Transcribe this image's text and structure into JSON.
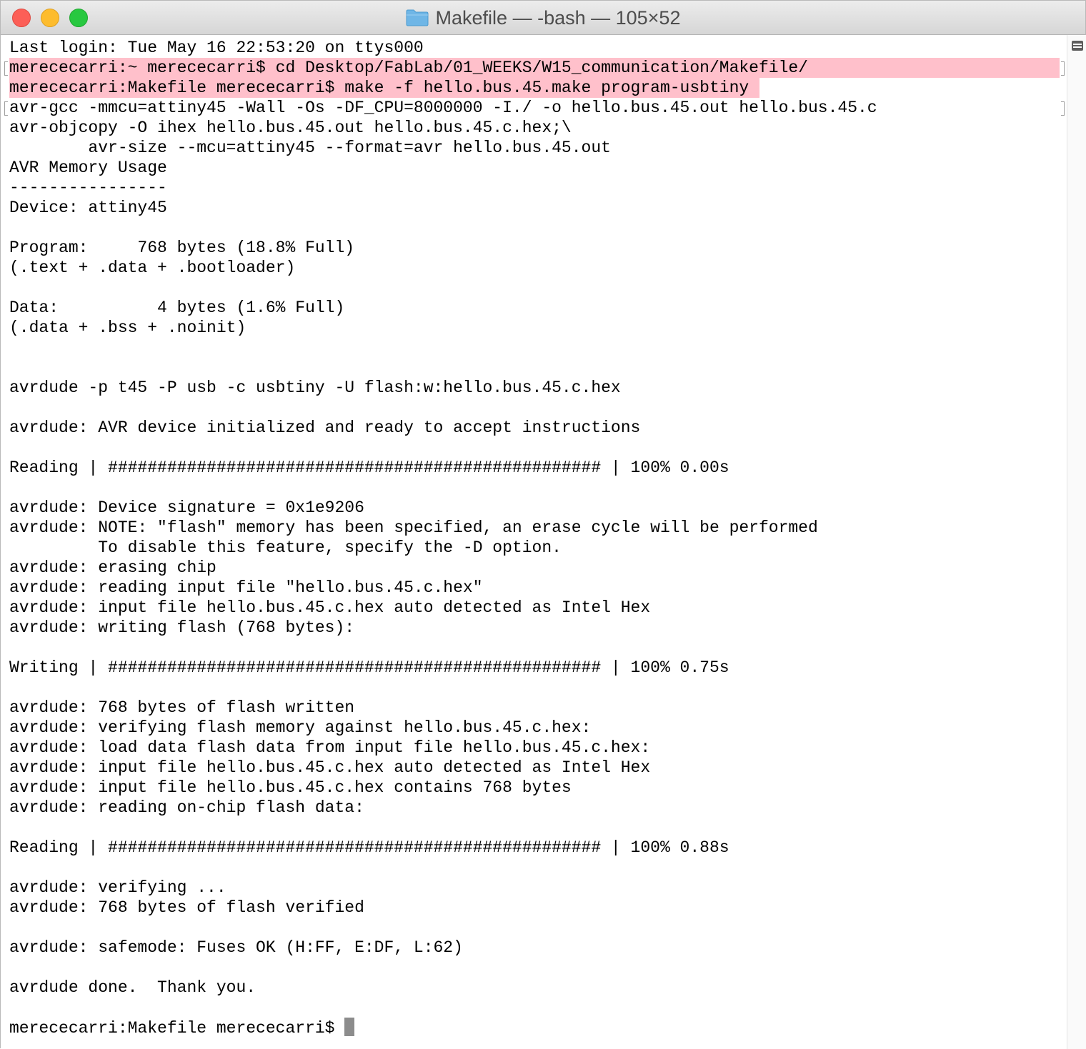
{
  "window": {
    "title": "Makefile — -bash — 105×52",
    "folder_icon": "folder-icon"
  },
  "colors": {
    "highlight": "#ffc0cb",
    "close": "#fc5f57",
    "minimize": "#fdbc2e",
    "maximize": "#28c840",
    "cursor": "#8c8c8c"
  },
  "terminal": {
    "lines": [
      "Last login: Tue May 16 22:53:20 on ttys000",
      "merececarri:~ merececarri$ cd Desktop/FabLab/01_WEEKS/W15_communication/Makefile/",
      "merececarri:Makefile merececarri$ make -f hello.bus.45.make program-usbtiny",
      "avr-gcc -mmcu=attiny45 -Wall -Os -DF_CPU=8000000 -I./ -o hello.bus.45.out hello.bus.45.c",
      "avr-objcopy -O ihex hello.bus.45.out hello.bus.45.c.hex;\\",
      "        avr-size --mcu=attiny45 --format=avr hello.bus.45.out",
      "AVR Memory Usage",
      "----------------",
      "Device: attiny45",
      "",
      "Program:     768 bytes (18.8% Full)",
      "(.text + .data + .bootloader)",
      "",
      "Data:          4 bytes (1.6% Full)",
      "(.data + .bss + .noinit)",
      "",
      "",
      "avrdude -p t45 -P usb -c usbtiny -U flash:w:hello.bus.45.c.hex",
      "",
      "avrdude: AVR device initialized and ready to accept instructions",
      "",
      "Reading | ################################################## | 100% 0.00s",
      "",
      "avrdude: Device signature = 0x1e9206",
      "avrdude: NOTE: \"flash\" memory has been specified, an erase cycle will be performed",
      "         To disable this feature, specify the -D option.",
      "avrdude: erasing chip",
      "avrdude: reading input file \"hello.bus.45.c.hex\"",
      "avrdude: input file hello.bus.45.c.hex auto detected as Intel Hex",
      "avrdude: writing flash (768 bytes):",
      "",
      "Writing | ################################################## | 100% 0.75s",
      "",
      "avrdude: 768 bytes of flash written",
      "avrdude: verifying flash memory against hello.bus.45.c.hex:",
      "avrdude: load data flash data from input file hello.bus.45.c.hex:",
      "avrdude: input file hello.bus.45.c.hex auto detected as Intel Hex",
      "avrdude: input file hello.bus.45.c.hex contains 768 bytes",
      "avrdude: reading on-chip flash data:",
      "",
      "Reading | ################################################## | 100% 0.88s",
      "",
      "avrdude: verifying ...",
      "avrdude: 768 bytes of flash verified",
      "",
      "avrdude: safemode: Fuses OK (H:FF, E:DF, L:62)",
      "",
      "avrdude done.  Thank you.",
      ""
    ],
    "prompt": "merececarri:Makefile merececarri$ "
  }
}
